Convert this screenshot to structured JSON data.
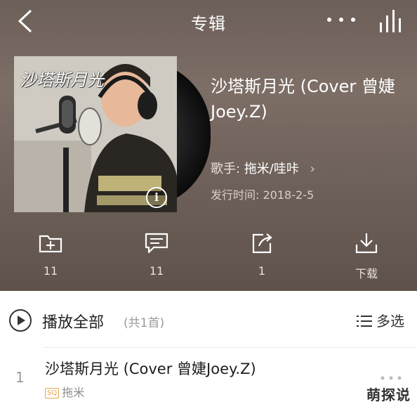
{
  "header": {
    "title": "专辑"
  },
  "album": {
    "cover_text": "沙塔斯月光",
    "name": "沙塔斯月光 (Cover 曾婕Joey.Z)",
    "singer_label": "歌手:",
    "singer_name": "拖米/哇咔",
    "release_label": "发行时间:",
    "release_date": "2018-2-5"
  },
  "actions": [
    {
      "icon": "add-folder-icon",
      "label": "11"
    },
    {
      "icon": "comment-icon",
      "label": "11"
    },
    {
      "icon": "share-icon",
      "label": "1"
    },
    {
      "icon": "download-icon",
      "label": "下载"
    }
  ],
  "playbar": {
    "play_all": "播放全部",
    "count": "(共1首)",
    "multi_select": "多选"
  },
  "songs": [
    {
      "index": "1",
      "title": "沙塔斯月光 (Cover 曾婕Joey.Z)",
      "quality_badge": "SQ",
      "artist": "拖米"
    }
  ],
  "watermark": "萌探说",
  "colors": {
    "hero_bg": "#6f625a",
    "accent_badge": "#e7a54a"
  }
}
